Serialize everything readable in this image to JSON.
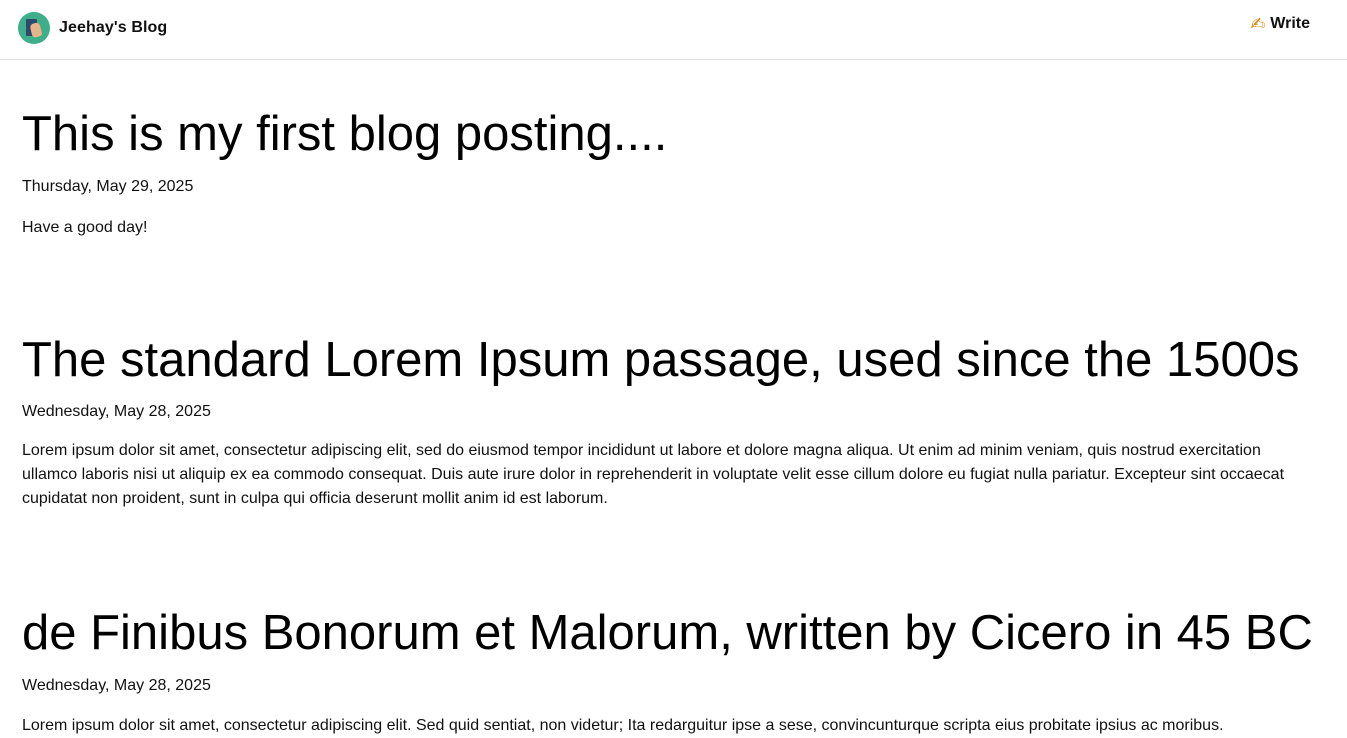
{
  "header": {
    "brand_title": "Jeehay's Blog",
    "avatar_icon": "reading-person-icon",
    "write_label": "Write",
    "write_icon": "writing-hand-icon"
  },
  "posts": [
    {
      "title": "This is my first blog posting....",
      "date": "Thursday, May 29, 2025",
      "body": "Have a good day!"
    },
    {
      "title": "The standard Lorem Ipsum passage, used since the 1500s",
      "date": "Wednesday, May 28, 2025",
      "body": "Lorem ipsum dolor sit amet, consectetur adipiscing elit, sed do eiusmod tempor incididunt ut labore et dolore magna aliqua. Ut enim ad minim veniam, quis nostrud exercitation ullamco laboris nisi ut aliquip ex ea commodo consequat. Duis aute irure dolor in reprehenderit in voluptate velit esse cillum dolore eu fugiat nulla pariatur. Excepteur sint occaecat cupidatat non proident, sunt in culpa qui officia deserunt mollit anim id est laborum."
    },
    {
      "title": "de Finibus Bonorum et Malorum, written by Cicero in 45 BC",
      "date": "Wednesday, May 28, 2025",
      "body": "Lorem ipsum dolor sit amet, consectetur adipiscing elit. Sed quid sentiat, non videtur; Ita redarguitur ipse a sese, convincunturque scripta eius probitate ipsius ac moribus."
    }
  ]
}
